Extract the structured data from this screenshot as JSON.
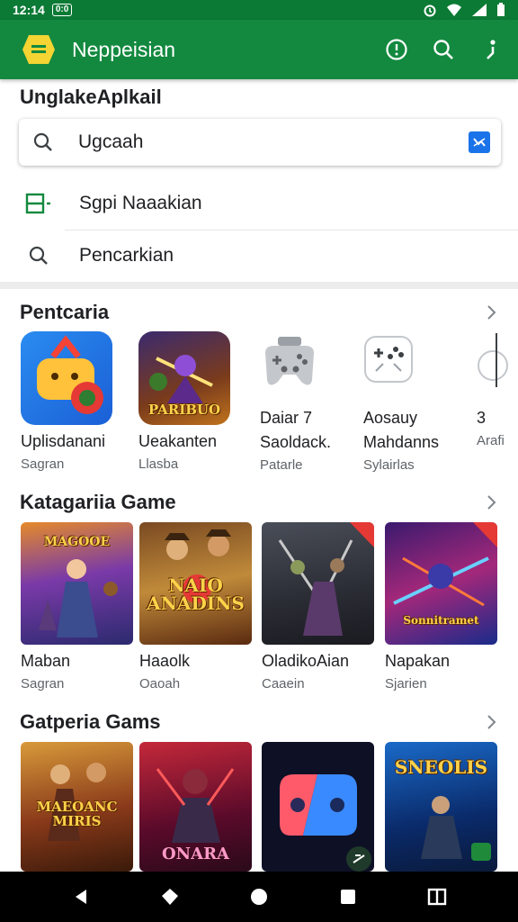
{
  "status_bar": {
    "time": "12:14",
    "badge": "0:0"
  },
  "app_bar": {
    "title": "Neppeisian"
  },
  "search_section": {
    "heading": "UnglakeAplkail",
    "search_value": "Ugcaah",
    "option_1": "Sgpi Naaakian",
    "option_2": "Pencarkian"
  },
  "section_1": {
    "title": "Pentcaria",
    "apps": [
      {
        "name": "Uplisdanani",
        "sub": "Sagran"
      },
      {
        "name": "Ueakanten",
        "sub": "Llasba",
        "art_text": "PARIBUO"
      },
      {
        "name": "Daiar 7",
        "name2": "Saoldack.",
        "sub": "Patarle"
      },
      {
        "name": "Aosauy",
        "name2": "Mahdanns",
        "sub": "Sylairlas"
      },
      {
        "name": "3",
        "name2": "Arafi"
      }
    ]
  },
  "section_2": {
    "title": "Katagariia Game",
    "cards": [
      {
        "name": "Maban",
        "sub": "Sagran",
        "art_text": "MAGOOE"
      },
      {
        "name": "Haaolk",
        "sub": "Oaoah",
        "art_text": "NAIO ANADINS"
      },
      {
        "name": "OladikoAian",
        "sub": "Caaein"
      },
      {
        "name": "Napakan",
        "sub": "Sjarien",
        "art_text": "Sonnitramet"
      }
    ]
  },
  "section_3": {
    "title": "Gatperia Gams",
    "cards": [
      {
        "art_text": "MAEOANC MIRIS"
      },
      {
        "art_text": "ONARA"
      },
      {
        "art_text": ""
      },
      {
        "art_text": "SNEOLIS"
      }
    ]
  },
  "colors": {
    "status": "#0b7a35",
    "appbar": "#13893f",
    "accent": "#1a73e8"
  }
}
